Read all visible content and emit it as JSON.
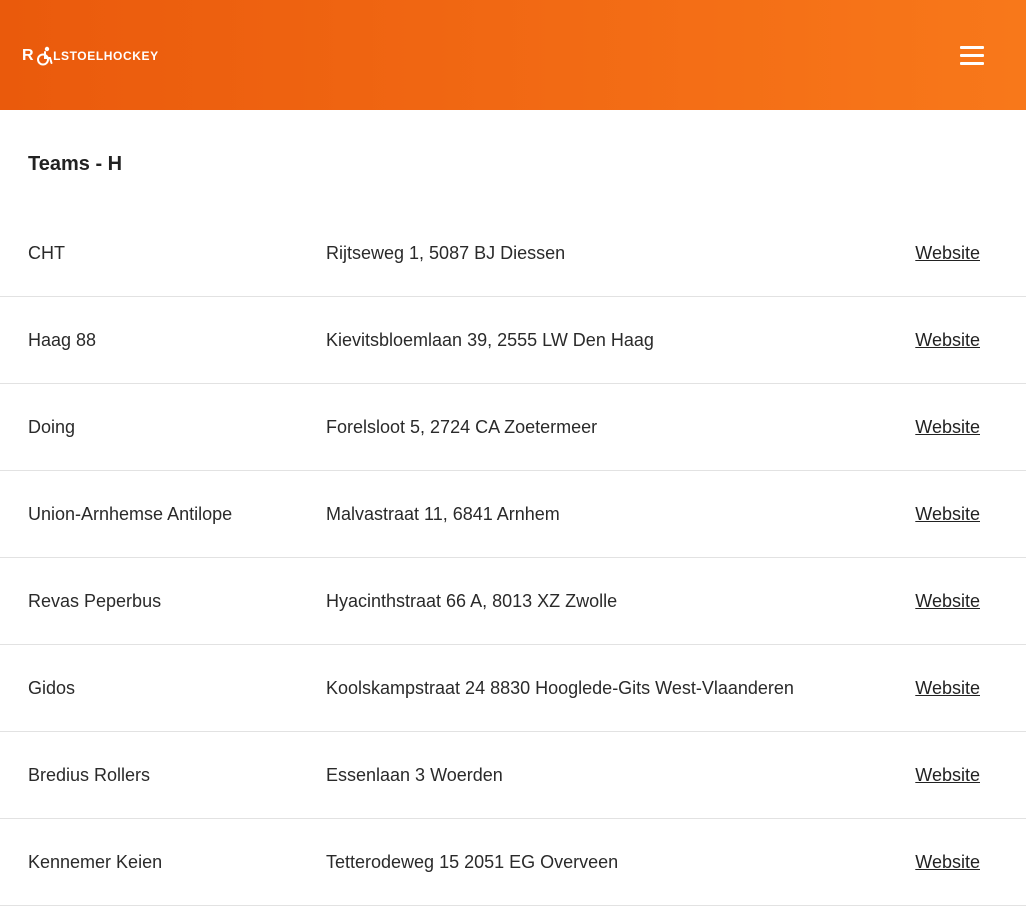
{
  "header": {
    "logo_letter": "R",
    "logo_text": "LSTOELHOCKEY",
    "logo_icon": "wheelchair-icon",
    "menu_icon": "hamburger-menu-icon",
    "background_colors": [
      "#ea5a0c",
      "#f8781a"
    ]
  },
  "page": {
    "title": "Teams - H"
  },
  "teams": [
    {
      "name": "CHT",
      "address": "Rijtseweg 1, 5087 BJ Diessen",
      "link": "Website"
    },
    {
      "name": "Haag 88",
      "address": "Kievitsbloemlaan 39, 2555 LW Den Haag",
      "link": "Website"
    },
    {
      "name": "Doing",
      "address": "Forelsloot 5, 2724 CA Zoetermeer",
      "link": "Website"
    },
    {
      "name": "Union-Arnhemse Antilope",
      "address": "Malvastraat 11, 6841 Arnhem",
      "link": "Website"
    },
    {
      "name": "Revas Peperbus",
      "address": "Hyacinthstraat 66 A, 8013 XZ Zwolle",
      "link": "Website"
    },
    {
      "name": "Gidos",
      "address": "Koolskampstraat 24 8830 Hooglede-Gits West-Vlaanderen",
      "link": "Website"
    },
    {
      "name": "Bredius Rollers",
      "address": "Essenlaan 3 Woerden",
      "link": "Website"
    },
    {
      "name": "Kennemer Keien",
      "address": "Tetterodeweg 15 2051 EG Overveen",
      "link": "Website"
    }
  ]
}
